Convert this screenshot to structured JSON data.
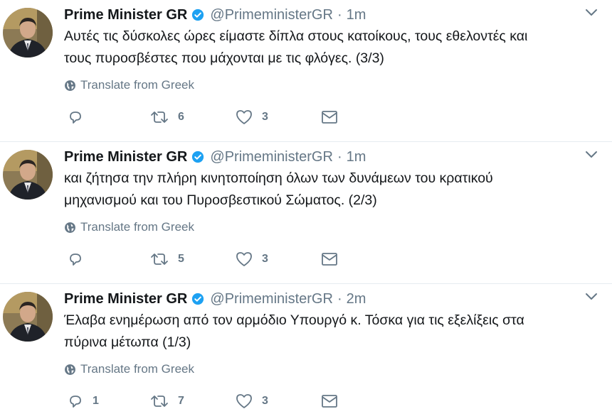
{
  "tweets": [
    {
      "author_name": "Prime Minister GR",
      "handle": "@PrimeministerGR",
      "separator": "·",
      "time": "1m",
      "lines": [
        "Αυτές τις δύσκολες ώρες είμαστε δίπλα στους κατοίκους, τους εθελοντές και",
        "τους πυροσβέστες που μάχονται με τις φλόγες. (3/3)"
      ],
      "translate": "Translate from Greek",
      "reply_count": "",
      "retweet_count": "6",
      "like_count": "3"
    },
    {
      "author_name": "Prime Minister GR",
      "handle": "@PrimeministerGR",
      "separator": "·",
      "time": "1m",
      "lines": [
        "και ζήτησα την πλήρη κινητοποίηση όλων των δυνάμεων του κρατικού",
        "μηχανισμού και του Πυροσβεστικού Σώματος. (2/3)"
      ],
      "translate": "Translate from Greek",
      "reply_count": "",
      "retweet_count": "5",
      "like_count": "3"
    },
    {
      "author_name": "Prime Minister GR",
      "handle": "@PrimeministerGR",
      "separator": "·",
      "time": "2m",
      "lines": [
        "Έλαβα ενημέρωση από τον αρμόδιο Υπουργό κ. Τόσκα για τις εξελίξεις στα",
        "πύρινα μέτωπα (1/3)"
      ],
      "translate": "Translate from Greek",
      "reply_count": "1",
      "retweet_count": "7",
      "like_count": "3"
    }
  ],
  "icons": {
    "verified": "verified-badge-icon",
    "caret": "chevron-down-icon",
    "globe": "globe-icon",
    "reply": "reply-icon",
    "retweet": "retweet-icon",
    "like": "heart-icon",
    "dm": "envelope-icon"
  },
  "colors": {
    "verified": "#1da1f2",
    "muted": "#657786",
    "text": "#14171a",
    "divider": "#e6ecf0"
  }
}
